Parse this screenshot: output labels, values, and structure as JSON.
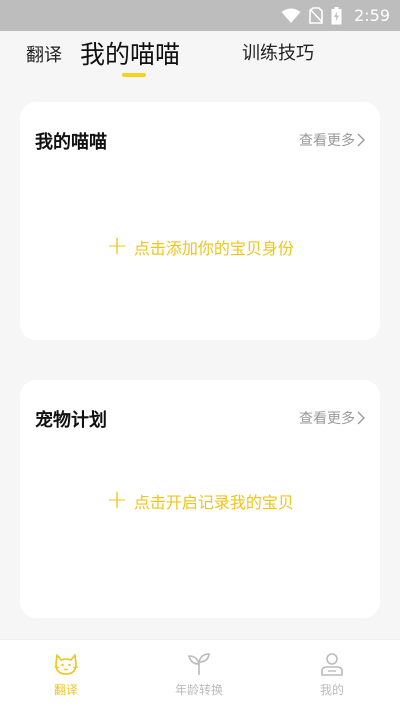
{
  "status_bar": {
    "time": "2:59",
    "icons": [
      "wifi-icon",
      "no-sim-icon",
      "battery-charging-icon"
    ]
  },
  "top_tabs": [
    {
      "label": "翻译"
    },
    {
      "label": "我的喵喵",
      "active": true
    },
    {
      "label": "训练技巧"
    }
  ],
  "cards": {
    "my_cat": {
      "title": "我的喵喵",
      "more_label": "查看更多",
      "action_label": "点击添加你的宝贝身份"
    },
    "pet_plan": {
      "title": "宠物计划",
      "more_label": "查看更多",
      "action_label": "点击开启记录我的宝贝"
    }
  },
  "bottom_nav": [
    {
      "label": "翻译",
      "icon": "cat-icon",
      "active": true
    },
    {
      "label": "年龄转换",
      "icon": "sprout-icon"
    },
    {
      "label": "我的",
      "icon": "person-icon"
    }
  ],
  "colors": {
    "accent": "#f0c419",
    "background": "#f6f6f6",
    "card": "#ffffff",
    "status_bar": "#bdbdbd",
    "inactive": "#bbbbbb"
  }
}
